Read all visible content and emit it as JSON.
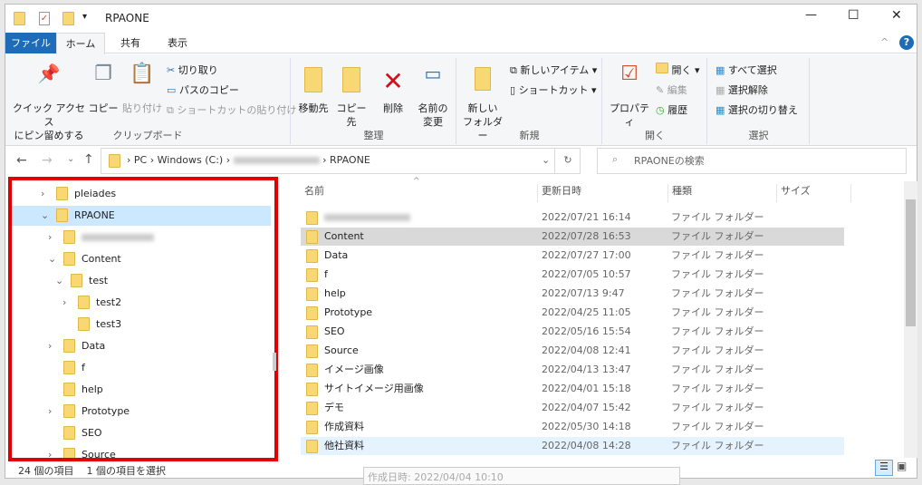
{
  "window": {
    "title": "RPAONE",
    "minimize": "—",
    "maximize": "☐",
    "close": "✕"
  },
  "tabs": [
    "ファイル",
    "ホーム",
    "共有",
    "表示"
  ],
  "ribbon": {
    "clipboard": {
      "label": "クリップボード",
      "pin": "クイック アクセス\nにピン留めする",
      "copy": "コピー",
      "paste": "貼り付け",
      "cut": "切り取り",
      "copy_path": "パスのコピー",
      "paste_shortcut": "ショートカットの貼り付け"
    },
    "organize": {
      "label": "整理",
      "move_to": "移動先",
      "copy_to": "コピー先",
      "delete": "削除",
      "rename": "名前の\n変更"
    },
    "new": {
      "label": "新規",
      "new_folder": "新しい\nフォルダー",
      "new_item": "新しいアイテム ▾",
      "shortcut": "ショートカット ▾"
    },
    "open": {
      "label": "開く",
      "properties": "プロパティ",
      "open": "開く ▾",
      "edit": "編集",
      "history": "履歴"
    },
    "select": {
      "label": "選択",
      "select_all": "すべて選択",
      "select_none": "選択解除",
      "invert": "選択の切り替え"
    }
  },
  "address": {
    "segments": [
      "PC",
      "Windows (C:)",
      "RPAONE"
    ],
    "search_placeholder": "RPAONEの検索"
  },
  "nav": [
    {
      "label": "pleiades",
      "level": 0,
      "chevron": "›"
    },
    {
      "label": "RPAONE",
      "level": 0,
      "chevron": "⌄",
      "selected": true
    },
    {
      "label": "",
      "level": 1,
      "chevron": "›",
      "blurred": true
    },
    {
      "label": "Content",
      "level": 1,
      "chevron": "⌄"
    },
    {
      "label": "test",
      "level": 2,
      "chevron": "⌄"
    },
    {
      "label": "test2",
      "level": 3,
      "chevron": "›"
    },
    {
      "label": "test3",
      "level": 3,
      "chevron": ""
    },
    {
      "label": "Data",
      "level": 1,
      "chevron": "›"
    },
    {
      "label": "f",
      "level": 1,
      "chevron": ""
    },
    {
      "label": "help",
      "level": 1,
      "chevron": ""
    },
    {
      "label": "Prototype",
      "level": 1,
      "chevron": "›"
    },
    {
      "label": "SEO",
      "level": 1,
      "chevron": ""
    },
    {
      "label": "Source",
      "level": 1,
      "chevron": "›"
    }
  ],
  "columns": {
    "name": "名前",
    "date": "更新日時",
    "type": "種類",
    "size": "サイズ"
  },
  "files": [
    {
      "name": "",
      "date": "2022/07/21 16:14",
      "type": "ファイル フォルダー",
      "blurred": true
    },
    {
      "name": "Content",
      "date": "2022/07/28 16:53",
      "type": "ファイル フォルダー",
      "state": "hover"
    },
    {
      "name": "Data",
      "date": "2022/07/27 17:00",
      "type": "ファイル フォルダー"
    },
    {
      "name": "f",
      "date": "2022/07/05 10:57",
      "type": "ファイル フォルダー"
    },
    {
      "name": "help",
      "date": "2022/07/13 9:47",
      "type": "ファイル フォルダー"
    },
    {
      "name": "Prototype",
      "date": "2022/04/25 11:05",
      "type": "ファイル フォルダー"
    },
    {
      "name": "SEO",
      "date": "2022/05/16 15:54",
      "type": "ファイル フォルダー"
    },
    {
      "name": "Source",
      "date": "2022/04/08 12:41",
      "type": "ファイル フォルダー"
    },
    {
      "name": "イメージ画像",
      "date": "2022/04/13 13:47",
      "type": "ファイル フォルダー"
    },
    {
      "name": "サイトイメージ用画像",
      "date": "2022/04/01 15:18",
      "type": "ファイル フォルダー"
    },
    {
      "name": "デモ",
      "date": "2022/04/07 15:42",
      "type": "ファイル フォルダー"
    },
    {
      "name": "作成資料",
      "date": "2022/05/30 14:18",
      "type": "ファイル フォルダー"
    },
    {
      "name": "他社資料",
      "date": "2022/04/08 14:28",
      "type": "ファイル フォルダー",
      "state": "selected"
    }
  ],
  "status": {
    "count": "24 個の項目",
    "selection": "1 個の項目を選択"
  },
  "tooltip": "作成日時: 2022/04/04 10:10",
  "colors": {
    "accent": "#1e6bb8",
    "highlight": "#cce8ff",
    "hover": "#d9d9d9",
    "selected": "#e5f3ff",
    "annotation": "#e00000"
  }
}
